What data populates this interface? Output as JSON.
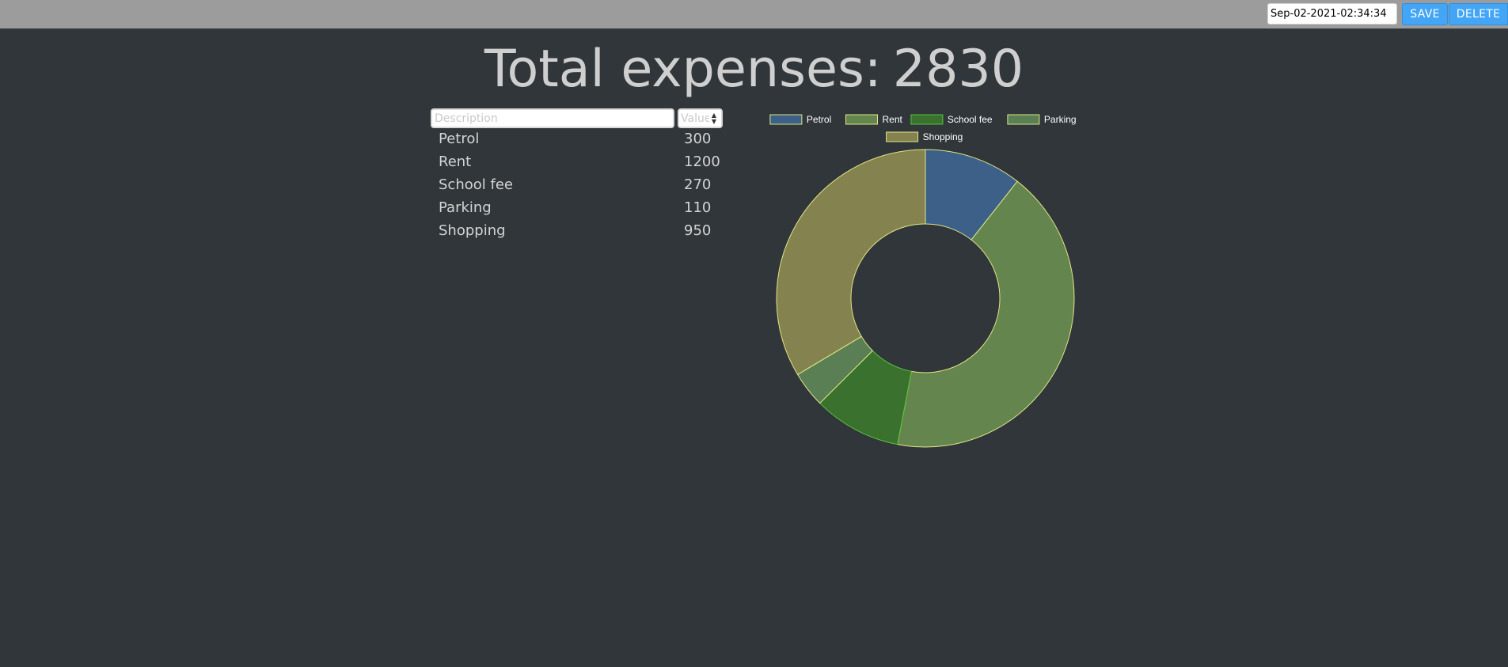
{
  "header": {
    "file_value": "Sep-02-2021-02:34:34",
    "save_label": "SAVE",
    "delete_label": "DELETE"
  },
  "summary": {
    "total_label": "Total expenses:",
    "total_value": "2830"
  },
  "form": {
    "description_placeholder": "Description",
    "value_placeholder": "Value"
  },
  "expenses": [
    {
      "description": "Petrol",
      "value": "300"
    },
    {
      "description": "Rent",
      "value": "1200"
    },
    {
      "description": "School fee",
      "value": "270"
    },
    {
      "description": "Parking",
      "value": "110"
    },
    {
      "description": "Shopping",
      "value": "950"
    }
  ],
  "colors": {
    "background": "#30363a",
    "topbar": "#9c9c9c",
    "button": "#42a5f5"
  },
  "chart_data": {
    "type": "pie",
    "variant": "doughnut",
    "categories": [
      "Petrol",
      "Rent",
      "School fee",
      "Parking",
      "Shopping"
    ],
    "values": [
      300,
      1200,
      270,
      110,
      950
    ],
    "colors": [
      "#3d6088",
      "#65854f",
      "#3a712f",
      "#5b7f55",
      "#84834f"
    ],
    "border_colors": [
      "#dfe683",
      "#dfe683",
      "#58c23a",
      "#dfe683",
      "#dfe683"
    ],
    "legend_position": "top"
  }
}
